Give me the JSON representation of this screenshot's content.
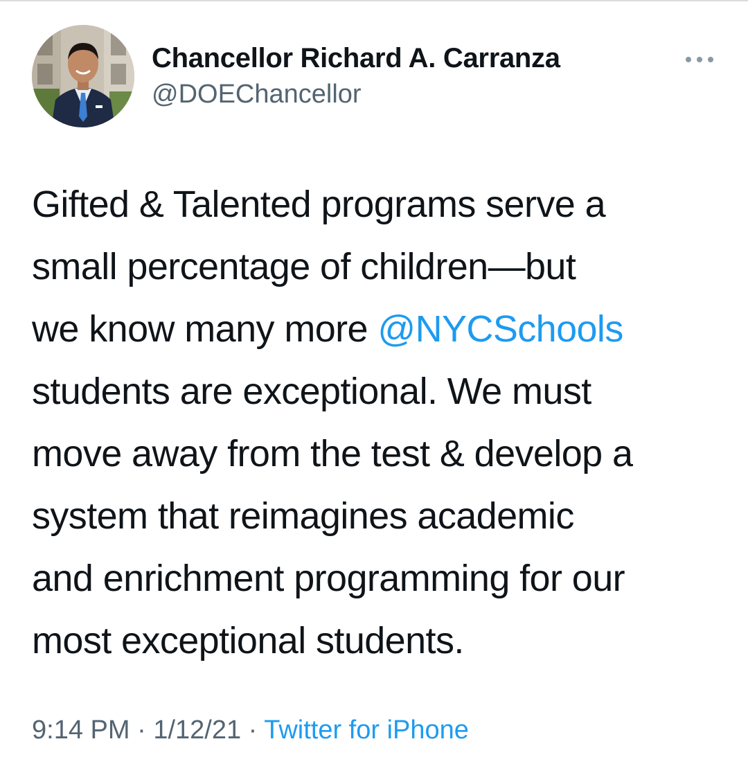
{
  "author": {
    "display_name": "Chancellor Richard A. Carranza",
    "handle": "@DOEChancellor"
  },
  "menu": {
    "icon": "more-horizontal-icon"
  },
  "tweet": {
    "lines": [
      {
        "before": "Gifted & Talented programs serve a"
      },
      {
        "before": "small percentage of children—but"
      },
      {
        "before": "we know many more ",
        "mention": "@NYCSchools"
      },
      {
        "before": "students are exceptional. We must"
      },
      {
        "before": "move away from the test & develop a"
      },
      {
        "before": "system that reimagines academic"
      },
      {
        "before": "and enrichment programming for our"
      },
      {
        "before": "most exceptional students."
      }
    ]
  },
  "meta": {
    "time": "9:14 PM",
    "sep1": " · ",
    "date": "1/12/21",
    "sep2": " · ",
    "source": "Twitter for iPhone"
  },
  "colors": {
    "accent": "#1d9bf0",
    "secondary_text": "#536471",
    "primary_text": "#0f1419"
  }
}
